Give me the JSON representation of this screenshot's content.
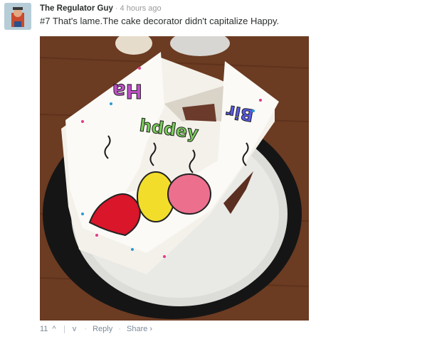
{
  "comment": {
    "author": "The Regulator Guy",
    "separator": "·",
    "timestamp": "4 hours ago",
    "text": "#7 That's lame.The cake decorator didn't capitalize Happy."
  },
  "image": {
    "icon": "photo-of-cut-birthday-cake",
    "cake_text_1": "Ha",
    "cake_text_2": "Bir",
    "cake_text_3": "hddey"
  },
  "actions": {
    "vote_count": "11",
    "upvote_icon": "^",
    "downvote_icon": "v",
    "reply_label": "Reply",
    "share_label": "Share",
    "share_chevron": "›",
    "dot": "·"
  },
  "colors": {
    "author": "#2a2e2e",
    "meta": "#7a8a99"
  }
}
